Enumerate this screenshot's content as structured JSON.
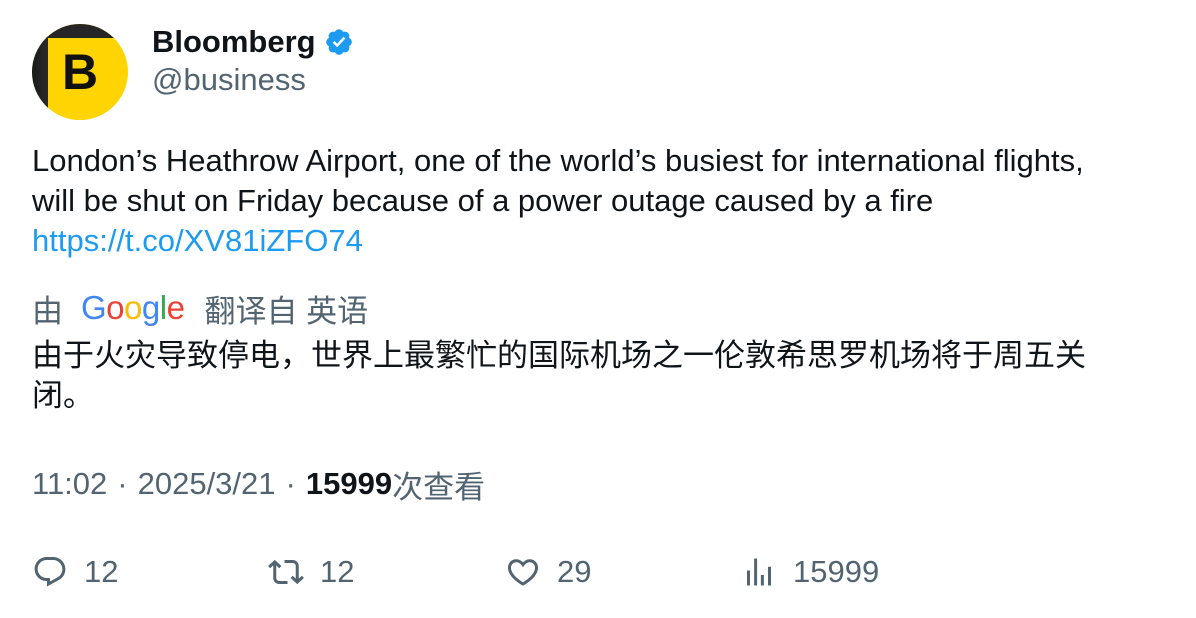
{
  "author": {
    "display_name": "Bloomberg",
    "handle": "@business",
    "avatar_letter": "B",
    "verified": true,
    "avatar_color": "#ffd400"
  },
  "tweet": {
    "text_line1": "London’s Heathrow Airport, one of the world’s busiest for international flights,",
    "text_line2": "will be shut on Friday because of a power outage caused by a fire",
    "link": "https://t.co/XV81iZFO74"
  },
  "translation": {
    "prefix": "由",
    "provider_letters": [
      "G",
      "o",
      "o",
      "g",
      "l",
      "e"
    ],
    "suffix": "翻译自 英语",
    "text_line1": "由于火灾导致停电，世界上最繁忙的国际机场之一伦敦希思罗机场将于周五关",
    "text_line2": "闭。"
  },
  "meta": {
    "time": "11:02",
    "separator": "·",
    "date": "2025/3/21",
    "views": "15999",
    "views_label": "次查看"
  },
  "actions": {
    "reply_count": "12",
    "retweet_count": "12",
    "like_count": "29",
    "views_count": "15999"
  },
  "colors": {
    "link": "#1d9bf0",
    "verified_badge": "#1d9bf0",
    "secondary_text": "#536471",
    "primary_text": "#0f1419",
    "google_blue": "#4285f4",
    "google_red": "#ea4335",
    "google_yellow": "#fbbc05",
    "google_green": "#34a853"
  },
  "icons": {
    "reply": "reply-icon",
    "retweet": "retweet-icon",
    "like": "heart-icon",
    "views": "analytics-icon",
    "verified": "verified-badge-icon"
  }
}
